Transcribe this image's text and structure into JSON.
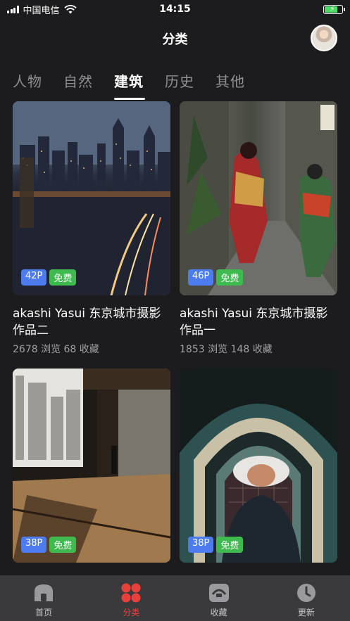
{
  "status_bar": {
    "carrier": "中国电信",
    "time": "14:15"
  },
  "header": {
    "title": "分类"
  },
  "tabs": [
    {
      "label": "人物",
      "active": false
    },
    {
      "label": "自然",
      "active": false
    },
    {
      "label": "建筑",
      "active": true
    },
    {
      "label": "历史",
      "active": false
    },
    {
      "label": "其他",
      "active": false
    }
  ],
  "cards": [
    {
      "count_badge": "42P",
      "free_badge": "免费",
      "title_line1": "akashi Yasui 东京城市摄影",
      "title_line2": "作品二",
      "stats": "2678 浏览 68 收藏"
    },
    {
      "count_badge": "46P",
      "free_badge": "免费",
      "title_line1": "akashi Yasui 东京城市摄影",
      "title_line2": "作品一",
      "stats": "1853 浏览 148 收藏"
    },
    {
      "count_badge": "38P",
      "free_badge": "免费"
    },
    {
      "count_badge": "38P",
      "free_badge": "免费"
    }
  ],
  "tabbar": [
    {
      "label": "首页",
      "icon": "home-icon",
      "active": false
    },
    {
      "label": "分类",
      "icon": "category-grid-icon",
      "active": true
    },
    {
      "label": "收藏",
      "icon": "favorites-icon",
      "active": false
    },
    {
      "label": "更新",
      "icon": "clock-icon",
      "active": false
    }
  ],
  "colors": {
    "background": "#1c1c1e",
    "tabbar_background": "#3a3a3c",
    "accent_red": "#e8413b",
    "badge_blue": "#4c7cf0",
    "badge_green": "#3fba4f"
  }
}
